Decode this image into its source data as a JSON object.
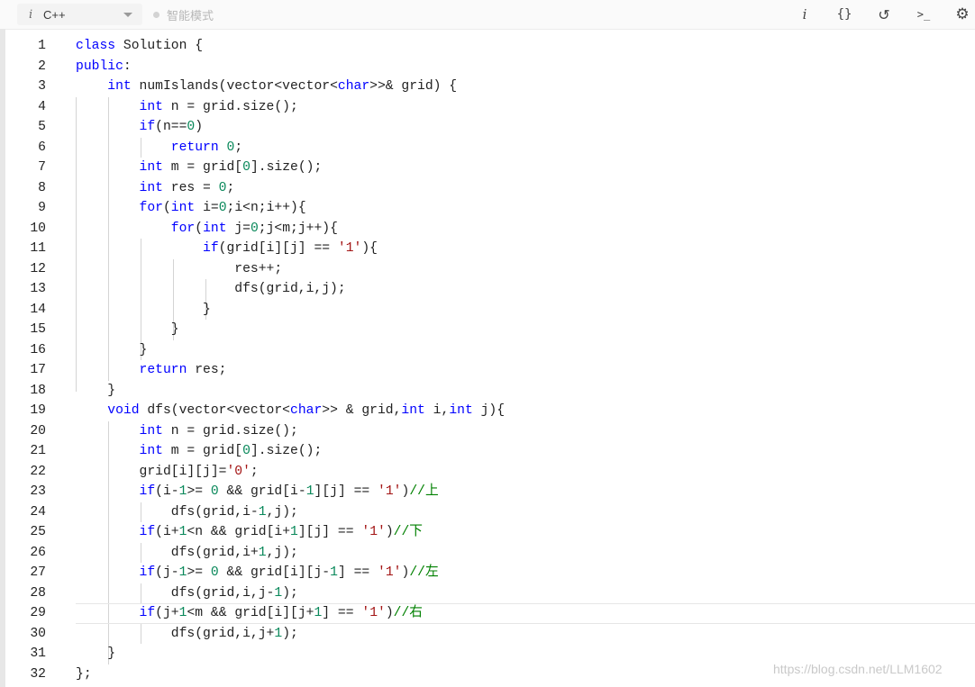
{
  "toolbar": {
    "info_glyph": "i",
    "language": "C++",
    "mode_label": "智能模式",
    "icons": [
      "info-icon",
      "braces-icon",
      "reset-icon",
      "terminal-icon",
      "settings-icon"
    ],
    "icon_glyphs": {
      "info": "i",
      "braces": "{}",
      "reset": "↺",
      "terminal": ">_",
      "settings": "⚙"
    }
  },
  "editor": {
    "current_line": 29,
    "syntax_colors": {
      "keyword": "#0000ff",
      "number": "#09885a",
      "string": "#a31515",
      "comment": "#008000",
      "text": "#222222"
    },
    "lines": [
      {
        "n": "1",
        "tokens": [
          [
            "k",
            "class"
          ],
          [
            "t",
            " Solution {"
          ]
        ]
      },
      {
        "n": "2",
        "tokens": [
          [
            "k",
            "public"
          ],
          [
            "t",
            ":"
          ]
        ]
      },
      {
        "n": "3",
        "tokens": [
          [
            "t",
            "    "
          ],
          [
            "k",
            "int"
          ],
          [
            "t",
            " numIslands(vector<vector<"
          ],
          [
            "k",
            "char"
          ],
          [
            "t",
            ">>& grid) {"
          ]
        ]
      },
      {
        "n": "4",
        "tokens": [
          [
            "t",
            "        "
          ],
          [
            "k",
            "int"
          ],
          [
            "t",
            " n = grid.size();"
          ]
        ]
      },
      {
        "n": "5",
        "tokens": [
          [
            "t",
            "        "
          ],
          [
            "k",
            "if"
          ],
          [
            "t",
            "(n=="
          ],
          [
            "n",
            "0"
          ],
          [
            "t",
            ")"
          ]
        ]
      },
      {
        "n": "6",
        "tokens": [
          [
            "t",
            "            "
          ],
          [
            "k",
            "return"
          ],
          [
            "t",
            " "
          ],
          [
            "n",
            "0"
          ],
          [
            "t",
            ";"
          ]
        ]
      },
      {
        "n": "7",
        "tokens": [
          [
            "t",
            "        "
          ],
          [
            "k",
            "int"
          ],
          [
            "t",
            " m = grid["
          ],
          [
            "n",
            "0"
          ],
          [
            "t",
            "].size();"
          ]
        ]
      },
      {
        "n": "8",
        "tokens": [
          [
            "t",
            "        "
          ],
          [
            "k",
            "int"
          ],
          [
            "t",
            " res = "
          ],
          [
            "n",
            "0"
          ],
          [
            "t",
            ";"
          ]
        ]
      },
      {
        "n": "9",
        "tokens": [
          [
            "t",
            "        "
          ],
          [
            "k",
            "for"
          ],
          [
            "t",
            "("
          ],
          [
            "k",
            "int"
          ],
          [
            "t",
            " i="
          ],
          [
            "n",
            "0"
          ],
          [
            "t",
            ";i<n;i++){"
          ]
        ]
      },
      {
        "n": "10",
        "tokens": [
          [
            "t",
            "            "
          ],
          [
            "k",
            "for"
          ],
          [
            "t",
            "("
          ],
          [
            "k",
            "int"
          ],
          [
            "t",
            " j="
          ],
          [
            "n",
            "0"
          ],
          [
            "t",
            ";j<m;j++){"
          ]
        ]
      },
      {
        "n": "11",
        "tokens": [
          [
            "t",
            "                "
          ],
          [
            "k",
            "if"
          ],
          [
            "t",
            "(grid[i][j] == "
          ],
          [
            "s",
            "'1'"
          ],
          [
            "t",
            "){"
          ]
        ]
      },
      {
        "n": "12",
        "tokens": [
          [
            "t",
            "                    res++;"
          ]
        ]
      },
      {
        "n": "13",
        "tokens": [
          [
            "t",
            "                    dfs(grid,i,j);"
          ]
        ]
      },
      {
        "n": "14",
        "tokens": [
          [
            "t",
            "                }"
          ]
        ]
      },
      {
        "n": "15",
        "tokens": [
          [
            "t",
            "            }"
          ]
        ]
      },
      {
        "n": "16",
        "tokens": [
          [
            "t",
            "        }"
          ]
        ]
      },
      {
        "n": "17",
        "tokens": [
          [
            "t",
            "        "
          ],
          [
            "k",
            "return"
          ],
          [
            "t",
            " res;"
          ]
        ]
      },
      {
        "n": "18",
        "tokens": [
          [
            "t",
            "    }"
          ]
        ]
      },
      {
        "n": "19",
        "tokens": [
          [
            "t",
            "    "
          ],
          [
            "k",
            "void"
          ],
          [
            "t",
            " dfs(vector<vector<"
          ],
          [
            "k",
            "char"
          ],
          [
            "t",
            ">> & grid,"
          ],
          [
            "k",
            "int"
          ],
          [
            "t",
            " i,"
          ],
          [
            "k",
            "int"
          ],
          [
            "t",
            " j){"
          ]
        ]
      },
      {
        "n": "20",
        "tokens": [
          [
            "t",
            "        "
          ],
          [
            "k",
            "int"
          ],
          [
            "t",
            " n = grid.size();"
          ]
        ]
      },
      {
        "n": "21",
        "tokens": [
          [
            "t",
            "        "
          ],
          [
            "k",
            "int"
          ],
          [
            "t",
            " m = grid["
          ],
          [
            "n",
            "0"
          ],
          [
            "t",
            "].size();"
          ]
        ]
      },
      {
        "n": "22",
        "tokens": [
          [
            "t",
            "        grid[i][j]="
          ],
          [
            "s",
            "'0'"
          ],
          [
            "t",
            ";"
          ]
        ]
      },
      {
        "n": "23",
        "tokens": [
          [
            "t",
            "        "
          ],
          [
            "k",
            "if"
          ],
          [
            "t",
            "(i-"
          ],
          [
            "n",
            "1"
          ],
          [
            "t",
            ">= "
          ],
          [
            "n",
            "0"
          ],
          [
            "t",
            " && grid[i-"
          ],
          [
            "n",
            "1"
          ],
          [
            "t",
            "][j] == "
          ],
          [
            "s",
            "'1'"
          ],
          [
            "t",
            ")"
          ],
          [
            "c",
            "//上"
          ]
        ]
      },
      {
        "n": "24",
        "tokens": [
          [
            "t",
            "            dfs(grid,i-"
          ],
          [
            "n",
            "1"
          ],
          [
            "t",
            ",j);"
          ]
        ]
      },
      {
        "n": "25",
        "tokens": [
          [
            "t",
            "        "
          ],
          [
            "k",
            "if"
          ],
          [
            "t",
            "(i+"
          ],
          [
            "n",
            "1"
          ],
          [
            "t",
            "<n && grid[i+"
          ],
          [
            "n",
            "1"
          ],
          [
            "t",
            "][j] == "
          ],
          [
            "s",
            "'1'"
          ],
          [
            "t",
            ")"
          ],
          [
            "c",
            "//下"
          ]
        ]
      },
      {
        "n": "26",
        "tokens": [
          [
            "t",
            "            dfs(grid,i+"
          ],
          [
            "n",
            "1"
          ],
          [
            "t",
            ",j);"
          ]
        ]
      },
      {
        "n": "27",
        "tokens": [
          [
            "t",
            "        "
          ],
          [
            "k",
            "if"
          ],
          [
            "t",
            "(j-"
          ],
          [
            "n",
            "1"
          ],
          [
            "t",
            ">= "
          ],
          [
            "n",
            "0"
          ],
          [
            "t",
            " && grid[i][j-"
          ],
          [
            "n",
            "1"
          ],
          [
            "t",
            "] == "
          ],
          [
            "s",
            "'1'"
          ],
          [
            "t",
            ")"
          ],
          [
            "c",
            "//左"
          ]
        ]
      },
      {
        "n": "28",
        "tokens": [
          [
            "t",
            "            dfs(grid,i,j-"
          ],
          [
            "n",
            "1"
          ],
          [
            "t",
            ");"
          ]
        ]
      },
      {
        "n": "29",
        "tokens": [
          [
            "t",
            "        "
          ],
          [
            "k",
            "if"
          ],
          [
            "t",
            "(j+"
          ],
          [
            "n",
            "1"
          ],
          [
            "t",
            "<m && grid[i][j+"
          ],
          [
            "n",
            "1"
          ],
          [
            "t",
            "] == "
          ],
          [
            "s",
            "'1'"
          ],
          [
            "t",
            ")"
          ],
          [
            "c",
            "//右"
          ]
        ]
      },
      {
        "n": "30",
        "tokens": [
          [
            "t",
            "            dfs(grid,i,j+"
          ],
          [
            "n",
            "1"
          ],
          [
            "t",
            ");"
          ]
        ]
      },
      {
        "n": "31",
        "tokens": [
          [
            "t",
            "    }"
          ]
        ]
      },
      {
        "n": "32",
        "tokens": [
          [
            "t",
            "};"
          ]
        ]
      }
    ]
  },
  "watermark": "https://blog.csdn.net/LLM1602"
}
